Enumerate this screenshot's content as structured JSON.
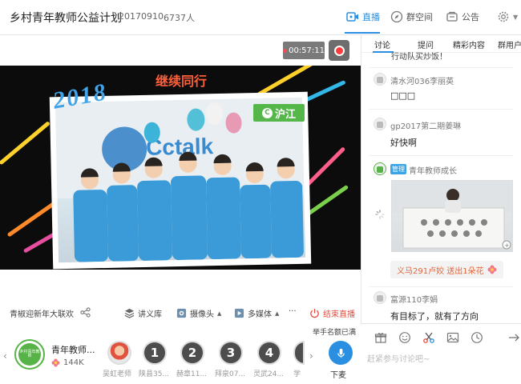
{
  "header": {
    "title": "乡村青年教师公益计划",
    "date": "20170910",
    "viewers": "6737人",
    "nav": [
      {
        "label": "直播",
        "icon": "live-icon",
        "active": true
      },
      {
        "label": "群空间",
        "icon": "compass-icon",
        "active": false
      },
      {
        "label": "公告",
        "icon": "notice-icon",
        "active": false
      }
    ]
  },
  "video": {
    "timer": "00:57:11",
    "caption": "继续同行",
    "year_text": "2018",
    "brand_text": "沪江"
  },
  "toolbar": {
    "course_title": "青椒迎新年大联欢",
    "lecture": "讲义库",
    "camera": "摄像头",
    "media": "多媒体",
    "more": "···",
    "end_live": "结束直播",
    "queue": "举手名额已满"
  },
  "bottom": {
    "group_name": "青年教师...",
    "group_logo_text": "乡村青年教师",
    "fans": "144K",
    "seats": [
      {
        "num": "",
        "label": "吴虹老师"
      },
      {
        "num": "1",
        "label": "陕县35..."
      },
      {
        "num": "2",
        "label": "赫章11..."
      },
      {
        "num": "3",
        "label": "拜泉07..."
      },
      {
        "num": "4",
        "label": "灵武24..."
      },
      {
        "num": "",
        "label": "学"
      }
    ],
    "mic_label": "下麦"
  },
  "side": {
    "tabs": [
      "讨论",
      "提问",
      "精彩内容",
      "群用户"
    ],
    "top_partial": "行动队买炒饭！",
    "messages": [
      {
        "name": "清水河036李丽英",
        "text": "□□□"
      },
      {
        "name": "gp2017第二期姜琳",
        "text": "好快啊"
      },
      {
        "name": "青年教师成长",
        "admin_badge": "管理"
      },
      {
        "gift": "义马291卢姣 送出1朵花"
      },
      {
        "name": "富源110李娟",
        "text": "有目标了，就有了方向"
      }
    ],
    "input_placeholder": "赶紧参与讨论吧~"
  },
  "colors": {
    "accent": "#2a8fe0",
    "end_live": "#e34b3d",
    "brand_green": "#55b74a"
  }
}
